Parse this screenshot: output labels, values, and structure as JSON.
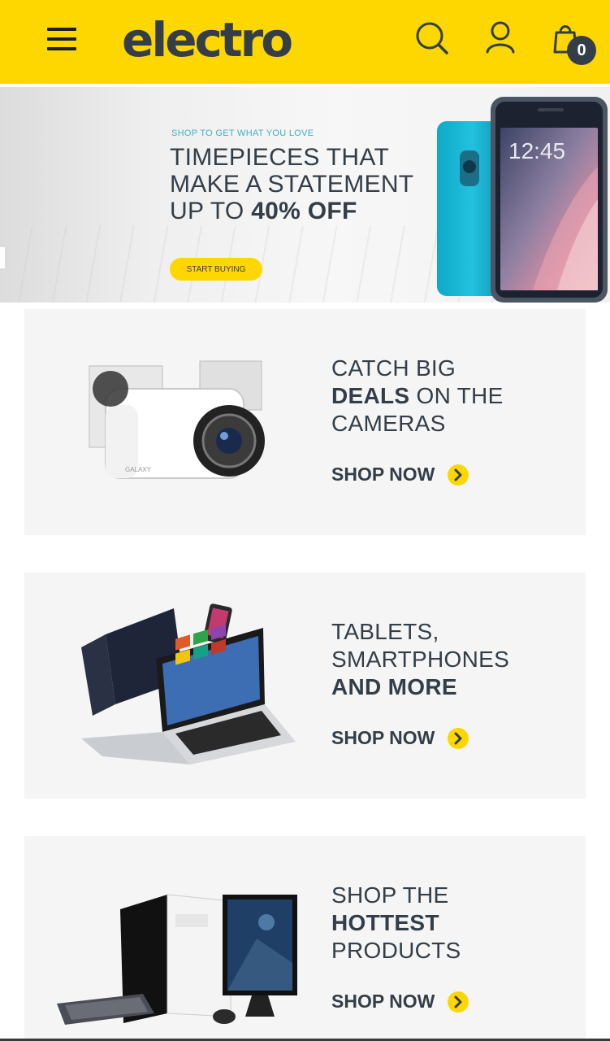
{
  "header": {
    "logo": "electro",
    "menu_icon": "hamburger-menu-icon",
    "search_icon": "search-icon",
    "account_icon": "user-icon",
    "cart_icon": "shopping-bag-icon",
    "cart_count": "0",
    "background_color": "#fed700"
  },
  "hero": {
    "kicker": "SHOP TO GET WHAT YOU LOVE",
    "title_line1": "TIMEPIECES THAT",
    "title_line2": "MAKE A STATEMENT",
    "title_line3_prefix": "UP TO ",
    "title_line3_bold": "40% OFF",
    "button_label": "START BUYING",
    "phone_time": "12:45"
  },
  "promos": [
    {
      "line1": "CATCH BIG",
      "line2_bold": "DEALS",
      "line2_rest": " ON THE",
      "line3": "CAMERAS",
      "cta": "SHOP NOW",
      "image": "camera"
    },
    {
      "line1": "TABLETS,",
      "line2": "SMARTPHONES",
      "line3_bold": "AND MORE",
      "cta": "SHOP NOW",
      "image": "laptop-tablet-phone"
    },
    {
      "line1": "SHOP THE",
      "line2_bold": "HOTTEST",
      "line3": "PRODUCTS",
      "cta": "SHOP NOW",
      "image": "desktop-pc"
    }
  ],
  "colors": {
    "accent": "#fed700",
    "text": "#333e48",
    "card_bg": "#f5f5f5",
    "kicker": "#3fb0c6"
  }
}
